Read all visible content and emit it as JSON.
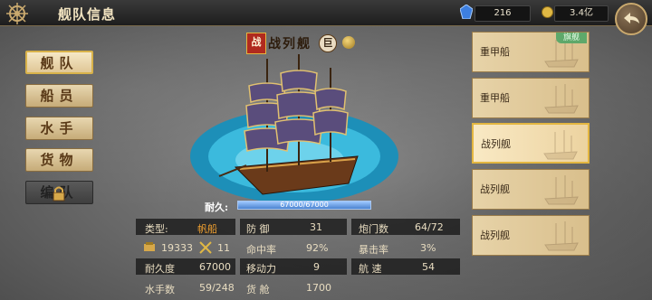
{
  "header": {
    "title": "舰队信息",
    "resource_gem": "216",
    "resource_coin": "3.4亿"
  },
  "menu": [
    {
      "label": "舰队",
      "active": true
    },
    {
      "label": "船员",
      "active": false
    },
    {
      "label": "水手",
      "active": false
    },
    {
      "label": "货物",
      "active": false
    },
    {
      "label": "编队",
      "active": false,
      "locked": true
    }
  ],
  "fleet": [
    {
      "name": "重甲船",
      "flag": "旗舰"
    },
    {
      "name": "重甲船"
    },
    {
      "name": "战列舰",
      "selected": true
    },
    {
      "name": "战列舰"
    },
    {
      "name": "战列舰"
    }
  ],
  "ship": {
    "badge": "战",
    "name": "战列舰",
    "size_badge": "巨",
    "durability_label": "耐久:",
    "durability_text": "67000/67000",
    "durability_fraction": 1.0
  },
  "stats": {
    "type_label": "类型:",
    "type_value": "帆船",
    "power": "19333",
    "rank": "11",
    "endurance_label": "耐久度",
    "endurance_value": "67000",
    "sailors_label": "水手数",
    "sailors_value": "59/248",
    "defense_label": "防 御",
    "defense_value": "31",
    "hit_label": "命中率",
    "hit_value": "92%",
    "move_label": "移动力",
    "move_value": "9",
    "cargo_label": "货 舱",
    "cargo_value": "1700",
    "cannon_label": "炮门数",
    "cannon_value": "64/72",
    "crit_label": "暴击率",
    "crit_value": "3%",
    "speed_label": "航 速",
    "speed_value": "54"
  }
}
